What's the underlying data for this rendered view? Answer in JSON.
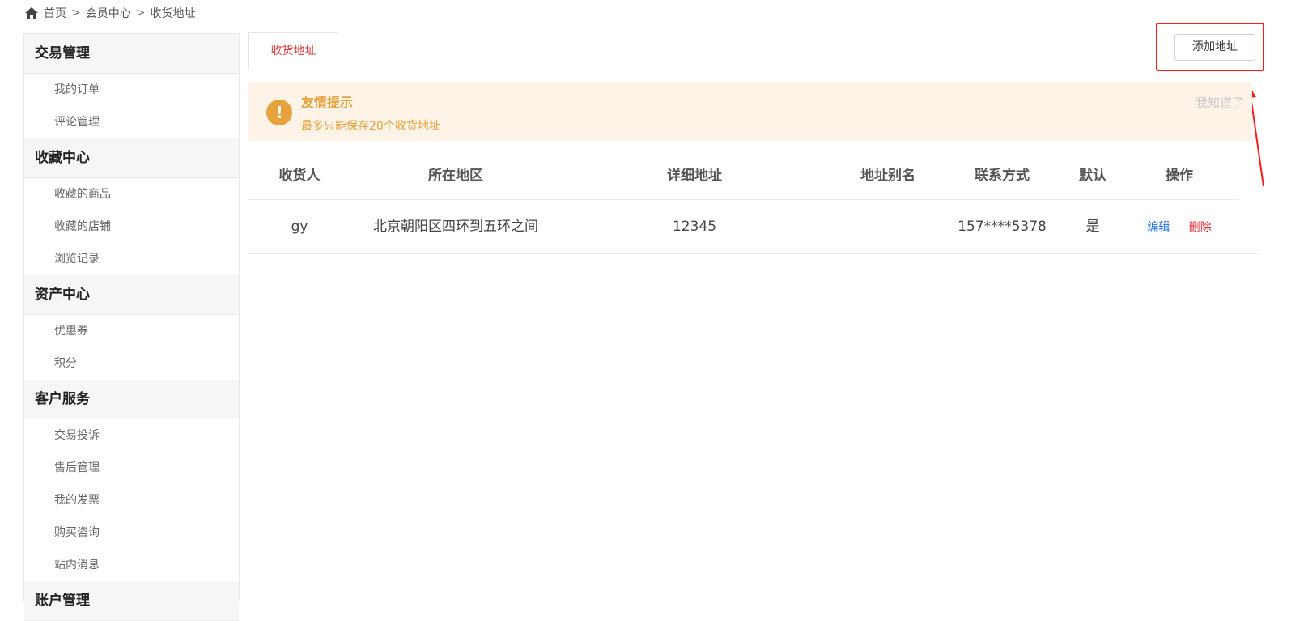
{
  "breadcrumb": {
    "items": [
      "首页",
      "会员中心",
      "收货地址"
    ],
    "separator": ">"
  },
  "sidebar": {
    "groups": [
      {
        "title": "交易管理",
        "items": [
          "我的订单",
          "评论管理"
        ]
      },
      {
        "title": "收藏中心",
        "items": [
          "收藏的商品",
          "收藏的店铺",
          "浏览记录"
        ]
      },
      {
        "title": "资产中心",
        "items": [
          "优惠券",
          "积分"
        ]
      },
      {
        "title": "客户服务",
        "items": [
          "交易投诉",
          "售后管理",
          "我的发票",
          "购买咨询",
          "站内消息"
        ]
      },
      {
        "title": "账户管理",
        "items": []
      }
    ]
  },
  "tabs": [
    {
      "label": "收货地址",
      "active": true
    }
  ],
  "toolbar": {
    "add_address_label": "添加地址"
  },
  "notice": {
    "title": "友情提示",
    "description": "最多只能保存20个收货地址",
    "dismiss_label": "我知道了"
  },
  "table": {
    "headers": [
      "收货人",
      "所在地区",
      "详细地址",
      "地址别名",
      "联系方式",
      "默认",
      "操作"
    ],
    "rows": [
      {
        "receiver": "gy",
        "region": "北京朝阳区四环到五环之间",
        "address": "12345",
        "alias": "",
        "phone": "157****5378",
        "default": "是",
        "actions": {
          "edit": "编辑",
          "delete": "删除"
        }
      }
    ]
  },
  "colors": {
    "accent_red": "#e4393c",
    "notice_orange": "#e6a23c",
    "notice_bg": "#fdf3e6",
    "link_blue": "#1a73e8",
    "annotation_red": "#ff1a1a"
  }
}
